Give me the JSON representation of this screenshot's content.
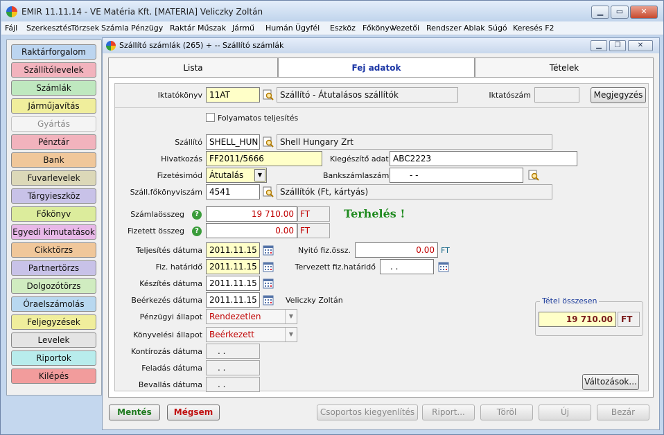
{
  "window": {
    "title": "EMIR 11.11.14 - VE Matéria Kft. [MATERIA] Veliczky Zoltán",
    "minimize": "▁",
    "maximize": "▭",
    "close": "✕"
  },
  "menu": [
    "Fájl",
    "Szerkesztés",
    "Törzsek",
    "Számla",
    "Pénzügy",
    "Raktár",
    "Műszak",
    "Jármű",
    "Humán",
    "Ügyfél",
    "Eszköz",
    "Főkönyv",
    "Vezetői",
    "Rendszer",
    "Ablak",
    "Súgó",
    "Keresés F2"
  ],
  "sidebar": [
    {
      "label": "Raktárforgalom",
      "color": "#bcd5f0"
    },
    {
      "label": "Szállítólevelek",
      "color": "#f2b3bd"
    },
    {
      "label": "Számlák",
      "color": "#bfe8bf"
    },
    {
      "label": "Járműjavítás",
      "color": "#f0ee9c"
    },
    {
      "label": "Gyártás",
      "color": "#f4f4f4",
      "disabled": true
    },
    {
      "label": "Pénztár",
      "color": "#f2b3bd"
    },
    {
      "label": "Bank",
      "color": "#f0c79a"
    },
    {
      "label": "Fuvarlevelek",
      "color": "#dcd8b8"
    },
    {
      "label": "Tárgyieszköz",
      "color": "#c8c2e8"
    },
    {
      "label": "Főkönyv",
      "color": "#dcec9c"
    },
    {
      "label": "Egyedi kimutatások",
      "color": "#e8b8e8"
    },
    {
      "label": "Cikktörzs",
      "color": "#f0c79a"
    },
    {
      "label": "Partnertörzs",
      "color": "#c8c2e8"
    },
    {
      "label": "Dolgozótörzs",
      "color": "#d0ecc0"
    },
    {
      "label": "Óraelszámolás",
      "color": "#b8d8f0"
    },
    {
      "label": "Feljegyzések",
      "color": "#f0ee9c"
    },
    {
      "label": "Levelek",
      "color": "#e4e4e4"
    },
    {
      "label": "Riportok",
      "color": "#b8ecec"
    },
    {
      "label": "Kilépés",
      "color": "#f29c9c"
    }
  ],
  "inner": {
    "title": "Szállító számlák (265) +  -- Szállító számlák",
    "tabs": [
      "Lista",
      "Fej adatok",
      "Tételek"
    ],
    "active_tab": 1
  },
  "form": {
    "iktatokonyv_label": "Iktatókönyv",
    "iktatokonyv_code": "11AT",
    "iktatokonyv_name": "Szállító - Átutalásos szállítók",
    "iktatoszam_label": "Iktatószám",
    "iktatoszam_value": "",
    "megjegyzes_button": "Megjegyzés",
    "folyamatos_label": "Folyamatos teljesítés",
    "szallito_label": "Szállító",
    "szallito_code": "SHELL_HUN",
    "szallito_name": "Shell Hungary Zrt",
    "hivatkozas_label": "Hivatkozás",
    "hivatkozas_value": "FF2011/5666",
    "kiegeszito_label": "Kiegészítő adat",
    "kiegeszito_value": "ABC2223",
    "fizetesimod_label": "Fizetésimód",
    "fizetesimod_value": "Átutalás",
    "bankszamla_label": "Bankszámlaszám",
    "bankszamla_value": "-        -",
    "fokonyv_label": "Száll.főkönyviszám",
    "fokonyv_code": "4541",
    "fokonyv_name": "Szállítók (Ft, kártyás)",
    "szamlaosszeg_label": "Számlaösszeg",
    "szamlaosszeg_value": "19 710.00",
    "szamlaosszeg_unit": "FT",
    "terheles_text": "Terhelés !",
    "fizetett_label": "Fizetett összeg",
    "fizetett_value": "0.00",
    "fizetett_unit": "FT",
    "teljesites_label": "Teljesítés dátuma",
    "teljesites_value": "2011.11.15",
    "nyito_label": "Nyitó fiz.össz.",
    "nyito_value": "0.00",
    "nyito_unit": "FT",
    "fizhatarido_label": "Fiz. határidő",
    "fizhatarido_value": "2011.11.15",
    "tervezett_label": "Tervezett fiz.határidő",
    "tervezett_value": ". .",
    "keszites_label": "Készítés dátuma",
    "keszites_value": "2011.11.15",
    "beerkezes_label": "Beérkezés dátuma",
    "beerkezes_value": "2011.11.15",
    "beerkezes_user": "Veliczky Zoltán",
    "penzugyi_label": "Pénzügyi állapot",
    "penzugyi_value": "Rendezetlen",
    "konyvelesi_label": "Könyvelési állapot",
    "konyvelesi_value": "Beérkezett",
    "kontirozas_label": "Kontírozás dátuma",
    "kontirozas_value": ". .",
    "feladas_label": "Feladás dátuma",
    "feladas_value": ". .",
    "bevallas_label": "Bevallás dátuma",
    "bevallas_value": ". .",
    "tetel_osszesen_label": "Tétel összesen",
    "tetel_osszesen_value": "19 710.00",
    "tetel_osszesen_unit": "FT",
    "valtozasok_button": "Változások..."
  },
  "footer": {
    "mentes": "Mentés",
    "megsem": "Mégsem",
    "csoportos": "Csoportos kiegyenlítés",
    "riport": "Riport...",
    "torol": "Töröl",
    "uj": "Új",
    "bezar": "Bezár"
  }
}
